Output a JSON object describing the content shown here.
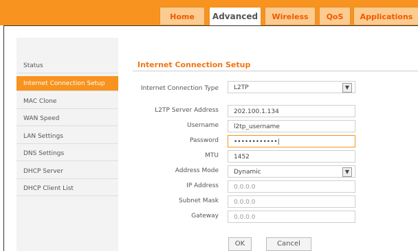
{
  "top_tabs": [
    {
      "label": "Home"
    },
    {
      "label": "Advanced"
    },
    {
      "label": "Wireless"
    },
    {
      "label": "QoS"
    },
    {
      "label": "Applications"
    }
  ],
  "sidebar_items": [
    {
      "label": "Status"
    },
    {
      "label": "Internet Connection Setup"
    },
    {
      "label": "MAC Clone"
    },
    {
      "label": "WAN Speed"
    },
    {
      "label": "LAN Settings"
    },
    {
      "label": "DNS Settings"
    },
    {
      "label": "DHCP Server"
    },
    {
      "label": "DHCP Client List"
    }
  ],
  "content": {
    "title": "Internet Connection Setup",
    "fields": {
      "connection_type": {
        "label": "Internet Connection Type",
        "value": "L2TP"
      },
      "server_address": {
        "label": "L2TP Server Address",
        "value": "202.100.1.134"
      },
      "username": {
        "label": "Username",
        "value": "l2tp_username"
      },
      "password": {
        "label": "Password",
        "value": "••••••••••••|"
      },
      "mtu": {
        "label": "MTU",
        "value": "1452"
      },
      "address_mode": {
        "label": "Address Mode",
        "value": "Dynamic"
      },
      "ip_address": {
        "label": "IP Address",
        "value": "0.0.0.0"
      },
      "subnet_mask": {
        "label": "Subnet Mask",
        "value": "0.0.0.0"
      },
      "gateway": {
        "label": "Gateway",
        "value": "0.0.0.0"
      }
    },
    "buttons": {
      "ok": "OK",
      "cancel": "Cancel"
    }
  },
  "colors": {
    "accent": "#f7931e",
    "title": "#f0750f"
  }
}
